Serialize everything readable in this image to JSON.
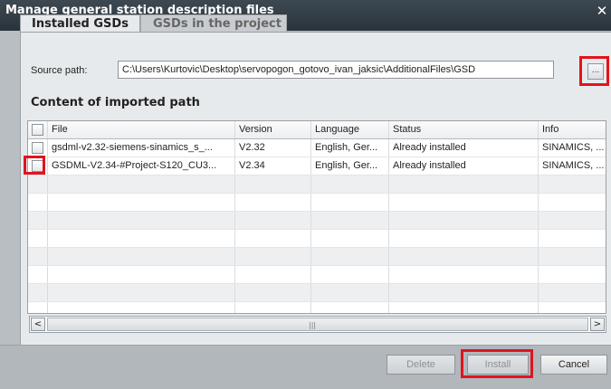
{
  "dialog": {
    "title": "Manage general station description files",
    "close_icon": "close-icon"
  },
  "tabs": [
    {
      "label": "Installed GSDs",
      "active": true
    },
    {
      "label": "GSDs in the project",
      "active": false
    }
  ],
  "source": {
    "label": "Source path:",
    "value": "C:\\Users\\Kurtovic\\Desktop\\servopogon_gotovo_ivan_jaksic\\AdditionalFiles\\GSD",
    "browse_label": "..."
  },
  "content": {
    "title": "Content of imported path",
    "columns": [
      "File",
      "Version",
      "Language",
      "Status",
      "Info"
    ],
    "rows": [
      {
        "file": "gsdml-v2.32-siemens-sinamics_s_...",
        "version": "V2.32",
        "language": "English, Ger...",
        "status": "Already installed",
        "info": "SINAMICS, ..."
      },
      {
        "file": "GSDML-V2.34-#Project-S120_CU3...",
        "version": "V2.34",
        "language": "English, Ger...",
        "status": "Already installed",
        "info": "SINAMICS, ..."
      }
    ]
  },
  "scrollbar": {
    "left_arrow": "<",
    "right_arrow": ">",
    "grip": "|||"
  },
  "buttons": {
    "delete": "Delete",
    "install": "Install",
    "cancel": "Cancel"
  },
  "colors": {
    "highlight": "#e0141e",
    "titlebar": "#2f3a42"
  }
}
